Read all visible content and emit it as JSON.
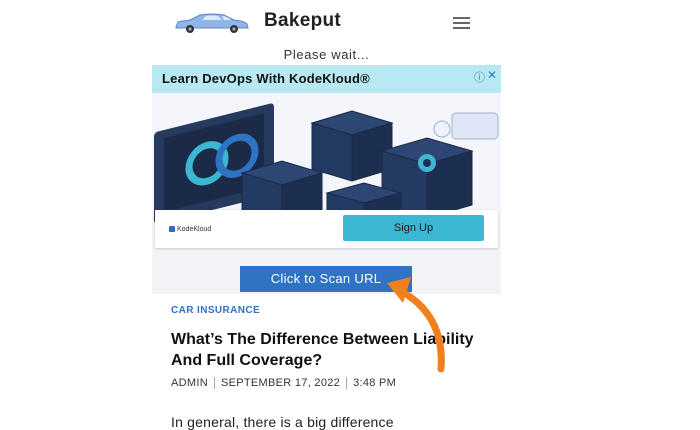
{
  "header": {
    "brand": "Bakeput",
    "logo_icon": "car-icon",
    "menu_icon": "hamburger-menu-icon"
  },
  "ad": {
    "please_wait": "Please wait...",
    "title": "Learn DevOps With KodeKloud®",
    "info_icon": "info-icon",
    "close_icon": "close-icon",
    "advertiser": "KodeKloud",
    "signup_label": "Sign Up",
    "image_icon": "kubernetes-devops-illustration"
  },
  "scan_button_label": "Click to Scan URL",
  "annotation_arrow_color": "#f07f1e",
  "article": {
    "category": "CAR INSURANCE",
    "title": "What’s The Difference Between Liability And Full Coverage?",
    "author": "ADMIN",
    "date": "SEPTEMBER 17, 2022",
    "time": "3:48 PM",
    "body": "In general, there is a big difference"
  },
  "colors": {
    "accent": "#2f73c4",
    "ad_banner": "#b8e8f1",
    "signup": "#3bb7d4"
  }
}
